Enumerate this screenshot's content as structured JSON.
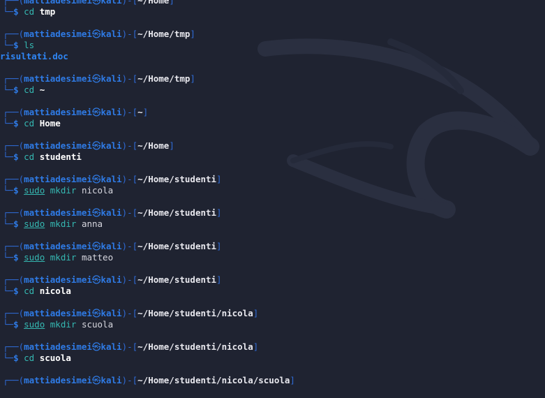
{
  "prompt": {
    "user": "mattiadesimei",
    "skull": "㉿",
    "host": "kali",
    "dollar": "$"
  },
  "entries": [
    {
      "path": "~/Home",
      "cmd": "cd",
      "args": "tmp",
      "args_bold": true
    },
    {
      "path": "~/Home/tmp",
      "cmd": "ls",
      "args": "",
      "args_bold": false,
      "output": "risultati.doc"
    },
    {
      "path": "~/Home/tmp",
      "cmd": "cd",
      "args": "~",
      "args_bold": true
    },
    {
      "path": "~",
      "cmd": "cd",
      "args": "Home",
      "args_bold": true
    },
    {
      "path": "~/Home",
      "cmd": "cd",
      "args": "studenti",
      "args_bold": true
    },
    {
      "path": "~/Home/studenti",
      "sudo": "sudo",
      "cmd": "mkdir",
      "args": "nicola",
      "args_bold": false
    },
    {
      "path": "~/Home/studenti",
      "sudo": "sudo",
      "cmd": "mkdir",
      "args": "anna",
      "args_bold": false
    },
    {
      "path": "~/Home/studenti",
      "sudo": "sudo",
      "cmd": "mkdir",
      "args": "matteo",
      "args_bold": false
    },
    {
      "path": "~/Home/studenti",
      "cmd": "cd",
      "args": "nicola",
      "args_bold": true
    },
    {
      "path": "~/Home/studenti/nicola",
      "sudo": "sudo",
      "cmd": "mkdir",
      "args": "scuola",
      "args_bold": false
    },
    {
      "path": "~/Home/studenti/nicola",
      "cmd": "cd",
      "args": "scuola",
      "args_bold": true
    },
    {
      "path": "~/Home/studenti/nicola/scuola"
    }
  ],
  "colors": {
    "background": "#1f2331",
    "prompt_blue": "#2f7be6",
    "command_teal": "#35b8b2",
    "path_white": "#e8e8ee"
  },
  "wallpaper": "kali-dragon-logo"
}
